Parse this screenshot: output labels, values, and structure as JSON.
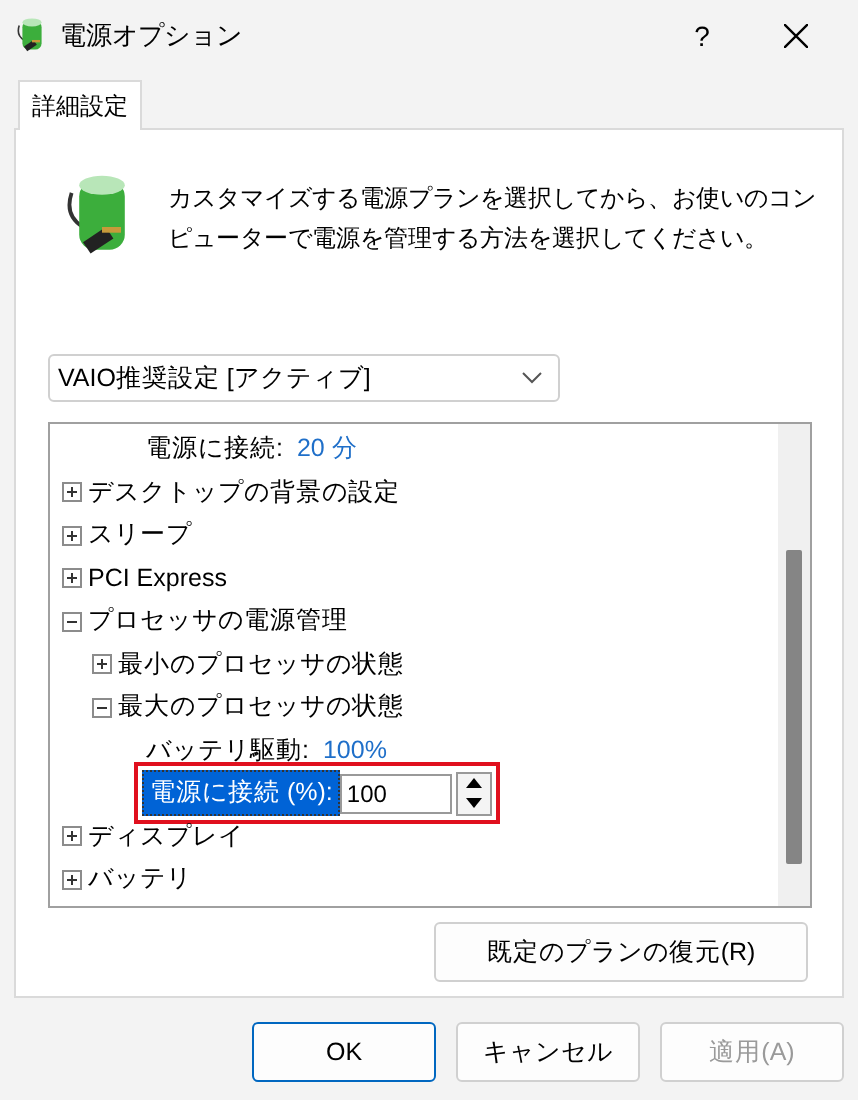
{
  "window": {
    "title": "電源オプション",
    "help": "?"
  },
  "tabs": [
    {
      "label": "詳細設定",
      "selected": true
    }
  ],
  "description": "カスタマイズする電源プランを選択してから、お使いのコンピューターで電源を管理する方法を選択してください。",
  "plan_select": {
    "value": "VAIO推奨設定 [アクティブ]"
  },
  "tree": {
    "items": [
      {
        "kind": "setting",
        "label": "電源に接続:",
        "value": "20 分"
      },
      {
        "kind": "group",
        "label": "デスクトップの背景の設定",
        "expanded": false
      },
      {
        "kind": "group",
        "label": "スリープ",
        "expanded": false
      },
      {
        "kind": "group",
        "label": "PCI Express",
        "expanded": false
      },
      {
        "kind": "group",
        "label": "プロセッサの電源管理",
        "expanded": true,
        "children": [
          {
            "kind": "group",
            "label": "最小のプロセッサの状態",
            "expanded": false
          },
          {
            "kind": "group",
            "label": "最大のプロセッサの状態",
            "expanded": true,
            "children": [
              {
                "kind": "setting",
                "label": "バッテリ駆動:",
                "value": "100%"
              },
              {
                "kind": "edit",
                "label": "電源に接続 (%):",
                "value": "100",
                "selected": true,
                "highlighted": true
              }
            ]
          }
        ]
      },
      {
        "kind": "group",
        "label": "ディスプレイ",
        "expanded": false
      },
      {
        "kind": "group",
        "label": "バッテリ",
        "expanded": false
      }
    ]
  },
  "restore_button": "既定のプランの復元(R)",
  "buttons": [
    {
      "label": "OK",
      "kind": "default",
      "disabled": false
    },
    {
      "label": "キャンセル",
      "kind": "normal",
      "disabled": false
    },
    {
      "label": "適用(A)",
      "kind": "normal",
      "disabled": true
    }
  ]
}
